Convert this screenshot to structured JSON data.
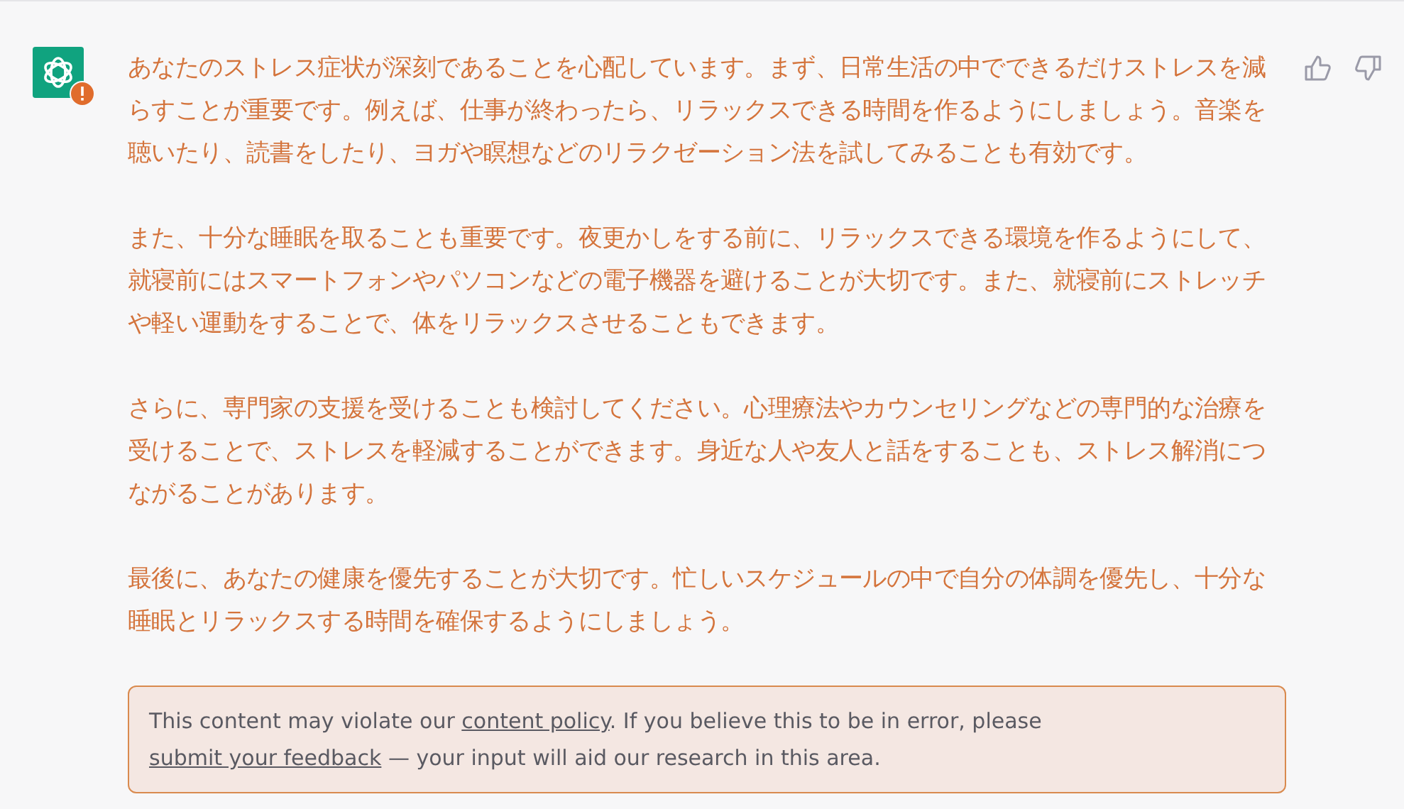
{
  "message": {
    "flagged": true,
    "paragraphs": [
      "あなたのストレス症状が深刻であることを心配しています。まず、日常生活の中でできるだけストレスを減らすことが重要です。例えば、仕事が終わったら、リラックスできる時間を作るようにしましょう。音楽を聴いたり、読書をしたり、ヨガや瞑想などのリラクゼーション法を試してみることも有効です。",
      "また、十分な睡眠を取ることも重要です。夜更かしをする前に、リラックスできる環境を作るようにして、就寝前にはスマートフォンやパソコンなどの電子機器を避けることが大切です。また、就寝前にストレッチや軽い運動をすることで、体をリラックスさせることもできます。",
      "さらに、専門家の支援を受けることも検討してください。心理療法やカウンセリングなどの専門的な治療を受けることで、ストレスを軽減することができます。身近な人や友人と話をすることも、ストレス解消につながることがあります。",
      "最後に、あなたの健康を優先することが大切です。忙しいスケジュールの中で自分の体調を優先し、十分な睡眠とリラックスする時間を確保するようにしましょう。"
    ],
    "notice": [
      {
        "kind": "text",
        "text": "This content may violate our "
      },
      {
        "kind": "link",
        "text": "content policy"
      },
      {
        "kind": "text",
        "text": ". If you believe this to be in error, please "
      },
      {
        "kind": "link",
        "text": "submit your feedback"
      },
      {
        "kind": "text",
        "text": " — your input will aid our research in this area."
      }
    ]
  }
}
